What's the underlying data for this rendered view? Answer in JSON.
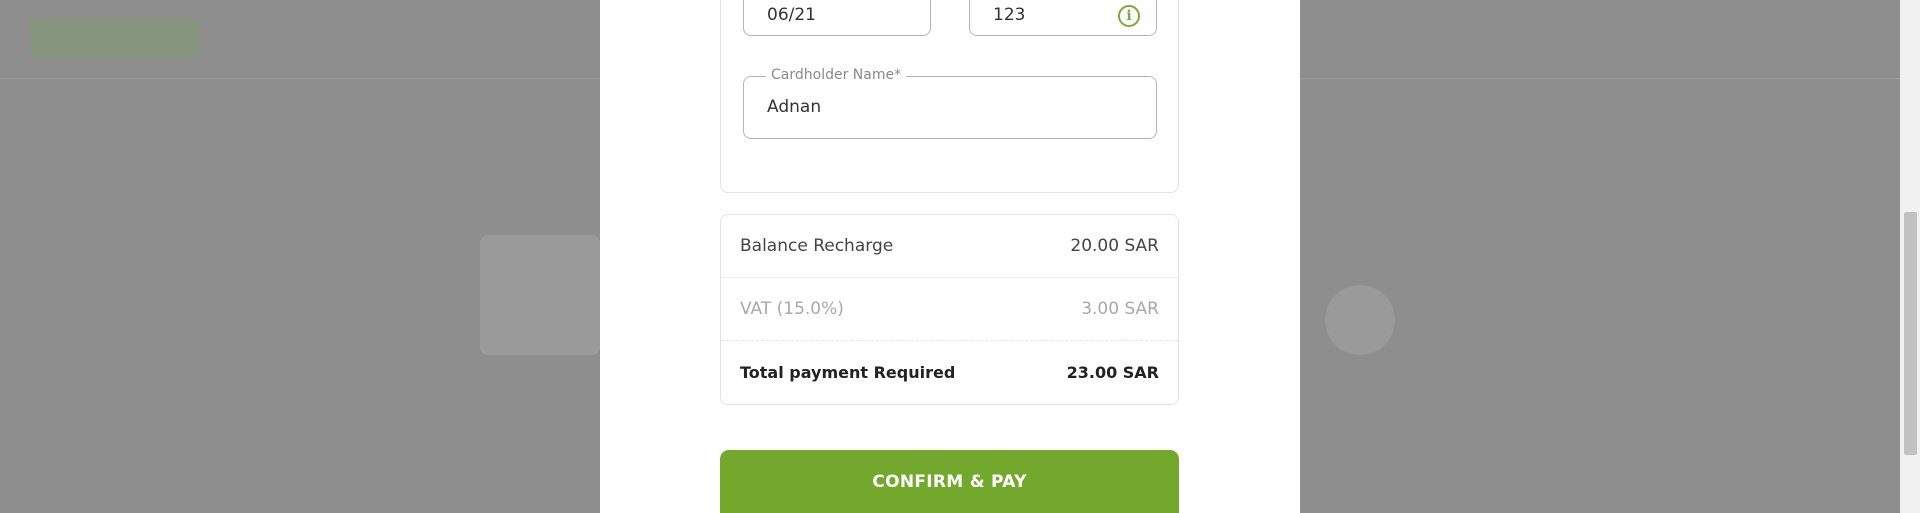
{
  "payment_form": {
    "expiry_value": "06/21",
    "cvv_value": "123",
    "cardholder_label": "Cardholder Name*",
    "cardholder_value": "Adnan"
  },
  "summary": {
    "balance_label": "Balance Recharge",
    "balance_value": "20.00 SAR",
    "vat_label": "VAT (15.0%)",
    "vat_value": "3.00 SAR",
    "total_label": "Total payment Required",
    "total_value": "23.00 SAR"
  },
  "actions": {
    "confirm_label": "CONFIRM & PAY"
  },
  "icons": {
    "cvv_info": "info-icon",
    "info_glyph": "i"
  },
  "colors": {
    "accent": "#72a92d",
    "overlay": "#8e8e8e"
  }
}
